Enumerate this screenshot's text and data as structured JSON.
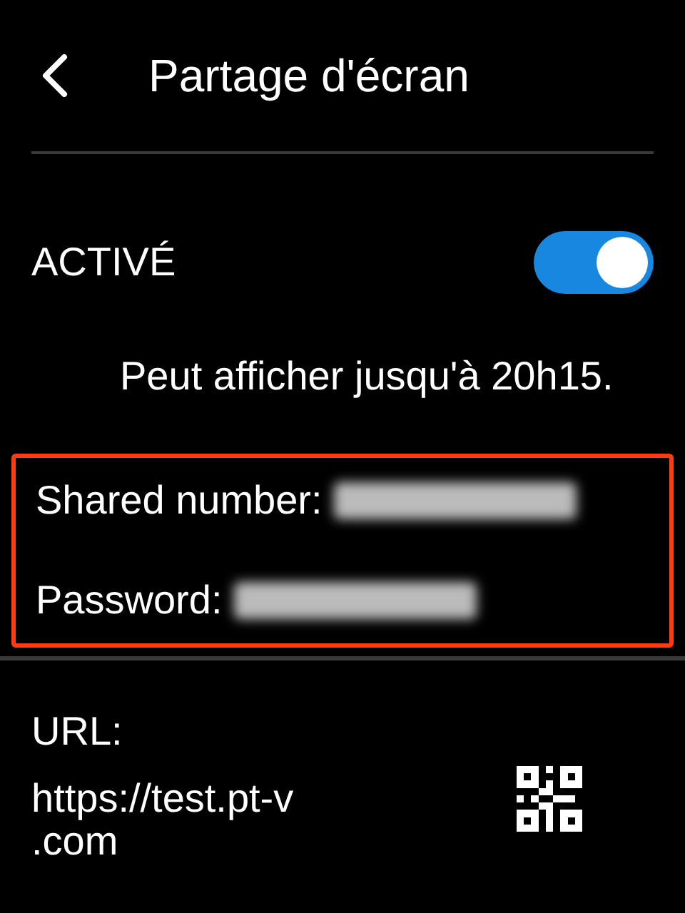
{
  "header": {
    "title": "Partage d'écran"
  },
  "toggle": {
    "label": "ACTIVÉ",
    "on": true
  },
  "note": "Peut afficher jusqu'à 20h15.",
  "credentials": [
    {
      "label": "Shared number:",
      "kind": "redacted"
    },
    {
      "label": "Password:",
      "kind": "redacted"
    }
  ],
  "url": {
    "label": "URL:",
    "lines": [
      "https://test.pt-v",
      ".com"
    ]
  }
}
